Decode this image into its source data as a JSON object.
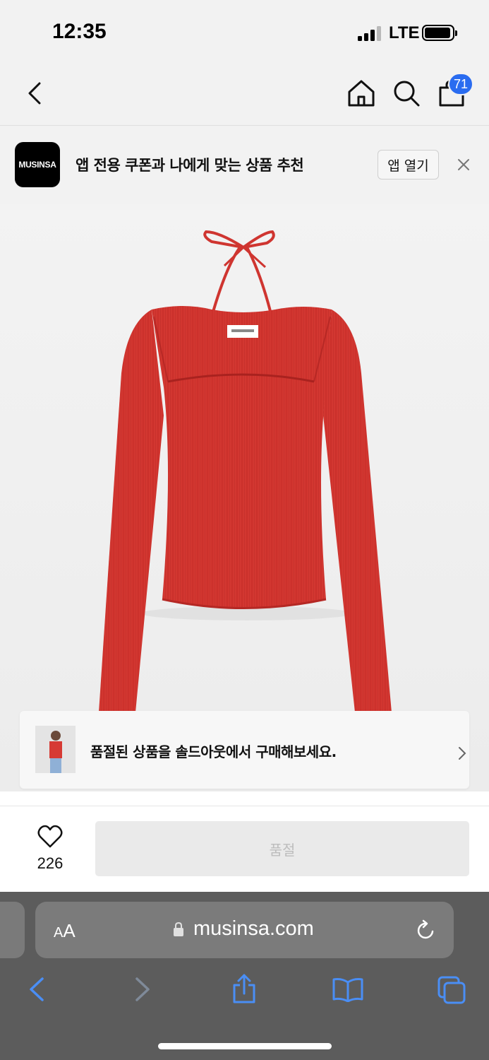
{
  "status_bar": {
    "time": "12:35",
    "network": "LTE"
  },
  "header": {
    "cart_count": "71",
    "icons": [
      "back-icon",
      "home-icon",
      "search-icon",
      "cart-icon"
    ]
  },
  "app_banner": {
    "logo_text": "MUSINSA",
    "text": "앱 전용 쿠폰과 나에게 맞는 상품 추천",
    "open_label": "앱 열기"
  },
  "product": {
    "image_alt": "red ribbed knit long-sleeve top with halter ribbon",
    "accent_color": "#d63a34"
  },
  "soldout_banner": {
    "text": "품절된 상품을 솔드아웃에서 구매해보세요."
  },
  "purchase": {
    "like_count": "226",
    "button_label": "품절"
  },
  "browser": {
    "aa_label_small": "A",
    "aa_label_big": "A",
    "url": "musinsa.com",
    "accent_color": "#4a8ef5"
  }
}
